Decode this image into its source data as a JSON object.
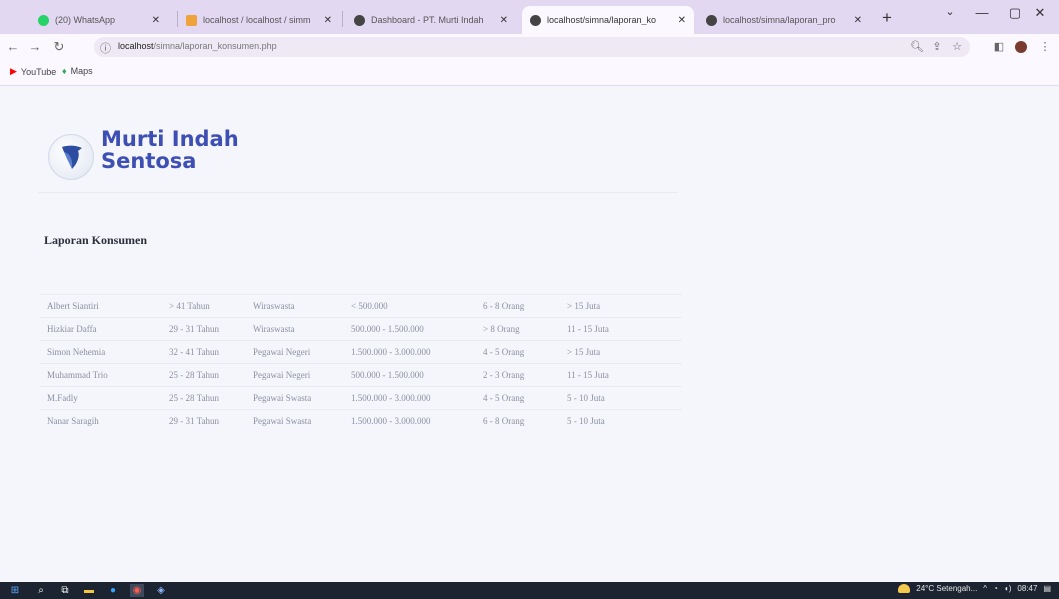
{
  "browser": {
    "tabs": [
      {
        "title": "(20) WhatsApp",
        "favicon_color": "#25d366",
        "active": false
      },
      {
        "title": "localhost / localhost / simm",
        "favicon_color": "#f0a23b",
        "active": false
      },
      {
        "title": "Dashboard - PT. Murti Indah",
        "favicon_color": "#444444",
        "active": false
      },
      {
        "title": "localhost/simna/laporan_ko",
        "favicon_color": "#444444",
        "active": true
      },
      {
        "title": "localhost/simna/laporan_pro",
        "favicon_color": "#444444",
        "active": false
      }
    ],
    "new_tab": "+",
    "window_controls": {
      "dropdown": "⌄",
      "minimize": "—",
      "maximize": "▢",
      "close": "✕"
    },
    "address": {
      "host": "localhost",
      "path": "/simna/laporan_konsumen.php"
    },
    "bookmarks": [
      {
        "label": "YouTube",
        "icon": "youtube-icon"
      },
      {
        "label": "Maps",
        "icon": "maps-icon"
      }
    ]
  },
  "page": {
    "brand": {
      "line1": "Murti Indah",
      "line2": "Sentosa",
      "color": "#3e4fb4"
    },
    "report_title": "Laporan Konsumen",
    "table": {
      "rows": [
        [
          "Albert Siantiri",
          "> 41 Tahun",
          "Wiraswasta",
          "< 500.000",
          "6 - 8 Orang",
          "> 15 Juta"
        ],
        [
          "Hizkiar Daffa",
          "29 - 31 Tahun",
          "Wiraswasta",
          "500.000 - 1.500.000",
          "> 8 Orang",
          "11 - 15 Juta"
        ],
        [
          "Simon Nehemia",
          "32 - 41 Tahun",
          "Pegawai Negeri",
          "1.500.000 - 3.000.000",
          "4 - 5 Orang",
          "> 15 Juta"
        ],
        [
          "Muhammad Trio",
          "25 - 28 Tahun",
          "Pegawai Negeri",
          "500.000 - 1.500.000",
          "2 - 3 Orang",
          "11 - 15 Juta"
        ],
        [
          "M.Fadly",
          "25 - 28 Tahun",
          "Pegawai Swasta",
          "1.500.000 - 3.000.000",
          "4 - 5 Orang",
          "5 - 10 Juta"
        ],
        [
          "Nanar Saragih",
          "29 - 31 Tahun",
          "Pegawai Swasta",
          "1.500.000 - 3.000.000",
          "6 - 8 Orang",
          "5 - 10 Juta"
        ]
      ]
    }
  },
  "taskbar": {
    "weather": "24°C Setengah...",
    "time": "08:47"
  }
}
